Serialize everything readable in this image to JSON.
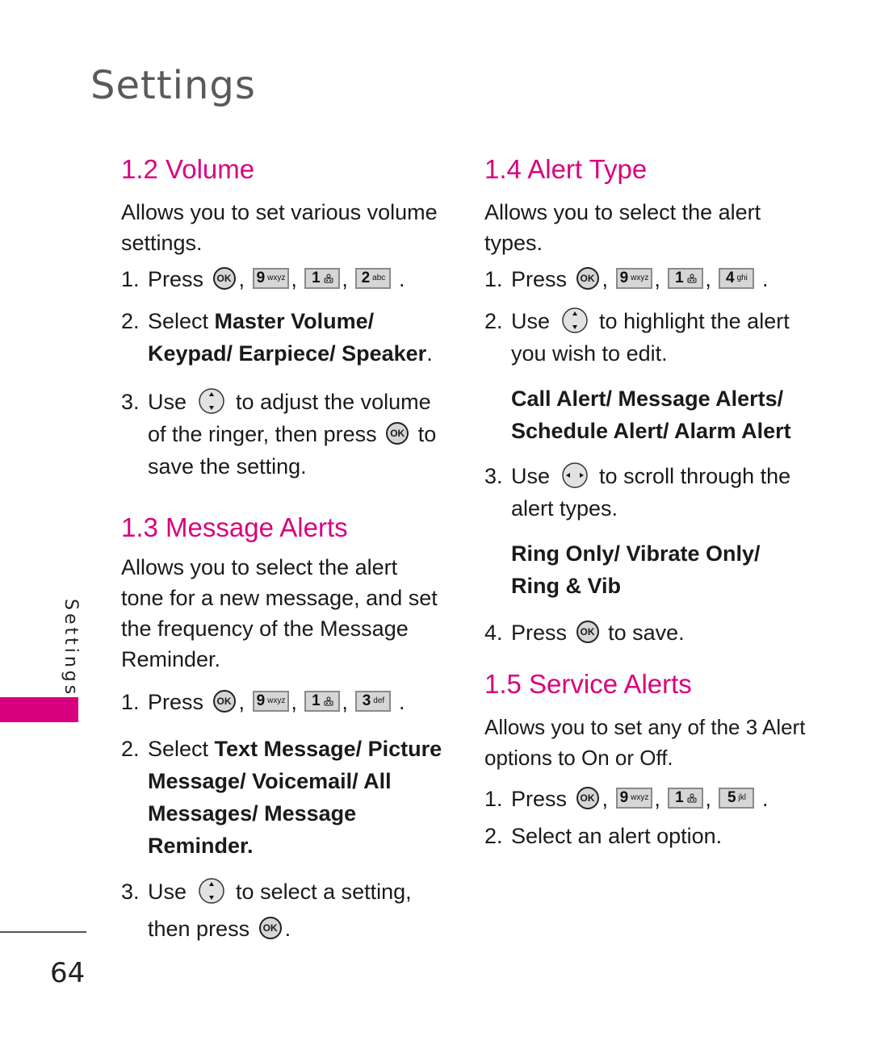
{
  "page": {
    "title": "Settings",
    "side_label": "Settings",
    "page_number": "64",
    "accent_color": "#d9007e"
  },
  "volume": {
    "heading": "1.2 Volume",
    "description": "Allows you to set various volume settings.",
    "step1": {
      "num": "1.",
      "text": "Press",
      "keys": [
        {
          "digit": "9",
          "letters": "wxyz"
        },
        {
          "digit": "1",
          "letters": "voicemail"
        },
        {
          "digit": "2",
          "letters": "abc"
        }
      ]
    },
    "step2": {
      "num": "2.",
      "prefix": "Select ",
      "options": "Master Volume/ Keypad/ Earpiece/ Speaker",
      "suffix": "."
    },
    "step3": {
      "num": "3.",
      "pre": "Use",
      "mid": "to adjust the volume of the ringer, then press",
      "post": "to save the setting."
    }
  },
  "message_alerts": {
    "heading": "1.3 Message Alerts",
    "description": "Allows you to select the alert tone for a new message, and set the frequency of the Message Reminder.",
    "step1": {
      "num": "1.",
      "text": "Press",
      "keys": [
        {
          "digit": "9",
          "letters": "wxyz"
        },
        {
          "digit": "1",
          "letters": "voicemail"
        },
        {
          "digit": "3",
          "letters": "def"
        }
      ]
    },
    "step2": {
      "num": "2.",
      "prefix": "Select ",
      "options": "Text Message/ Picture Message/ Voicemail/ All Messages/ Message Reminder."
    },
    "step3": {
      "num": "3.",
      "pre": "Use",
      "mid": "to select a setting, then press",
      "post": "."
    }
  },
  "alert_type": {
    "heading": "1.4 Alert Type",
    "description": "Allows you to select the alert types.",
    "step1": {
      "num": "1.",
      "text": "Press",
      "keys": [
        {
          "digit": "9",
          "letters": "wxyz"
        },
        {
          "digit": "1",
          "letters": "voicemail"
        },
        {
          "digit": "4",
          "letters": "ghi"
        }
      ]
    },
    "step2": {
      "num": "2.",
      "pre": "Use",
      "post": "to highlight the alert you wish to edit."
    },
    "step2_options": "Call Alert/ Message Alerts/ Schedule Alert/ Alarm Alert",
    "step3": {
      "num": "3.",
      "pre": "Use",
      "post": "to scroll through the alert types."
    },
    "step3_options": "Ring Only/ Vibrate Only/ Ring & Vib",
    "step4": {
      "num": "4.",
      "pre": "Press",
      "post": "to save."
    }
  },
  "service_alerts": {
    "heading": "1.5 Service Alerts",
    "description": "Allows you to set any of the 3 Alert options to On or Off.",
    "step1": {
      "num": "1.",
      "text": "Press",
      "keys": [
        {
          "digit": "9",
          "letters": "wxyz"
        },
        {
          "digit": "1",
          "letters": "voicemail"
        },
        {
          "digit": "5",
          "letters": "jkl"
        }
      ]
    },
    "step2": {
      "num": "2.",
      "text": "Select an alert option."
    }
  },
  "icons": {
    "ok_label": "OK",
    "comma": ",",
    "period": "."
  }
}
